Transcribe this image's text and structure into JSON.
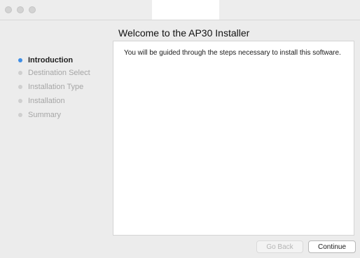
{
  "window": {
    "heading": "Welcome to the AP30 Installer"
  },
  "sidebar": {
    "steps": [
      {
        "label": "Introduction",
        "state": "active"
      },
      {
        "label": "Destination Select",
        "state": "pending"
      },
      {
        "label": "Installation Type",
        "state": "pending"
      },
      {
        "label": "Installation",
        "state": "pending"
      },
      {
        "label": "Summary",
        "state": "pending"
      }
    ]
  },
  "content": {
    "body": "You will be guided through the steps necessary to install this software."
  },
  "footer": {
    "back_label": "Go Back",
    "continue_label": "Continue"
  },
  "colors": {
    "active_step": "#3f8ee6",
    "inactive_step": "#cfcfcf"
  }
}
